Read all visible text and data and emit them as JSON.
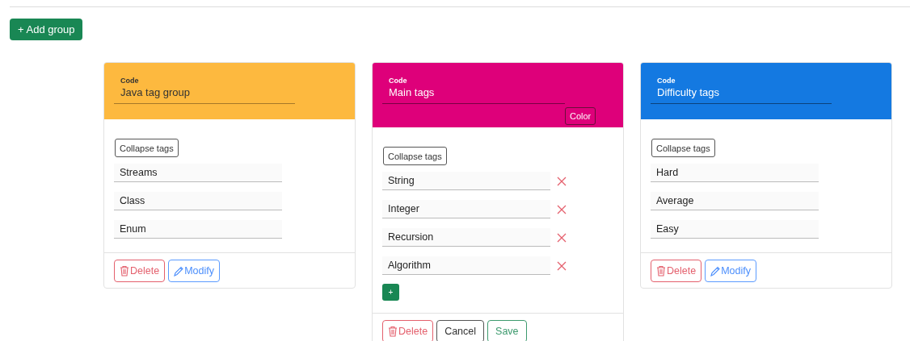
{
  "add_button": "+ Add group",
  "groups": [
    {
      "code_label": "Code",
      "code": "Java tag group",
      "color": "#fdb93f",
      "editing": false,
      "collapse_button": "Collapse tags",
      "tags": [
        "Streams",
        "Class",
        "Enum"
      ],
      "delete_button": "Delete",
      "modify_button": "Modify"
    },
    {
      "code_label": "Code",
      "code": "Main tags",
      "color": "#de007a",
      "editing": true,
      "color_button": "Color",
      "collapse_button": "Collapse tags",
      "tags": [
        "String",
        "Integer",
        "Recursion",
        "Algorithm"
      ],
      "add_tag_button": "+",
      "delete_button": "Delete",
      "cancel_button": "Cancel",
      "save_button": "Save"
    },
    {
      "code_label": "Code",
      "code": "Difficulty tags",
      "color": "#1479e1",
      "editing": false,
      "collapse_button": "Collapse tags",
      "tags": [
        "Hard",
        "Average",
        "Easy"
      ],
      "delete_button": "Delete",
      "modify_button": "Modify"
    }
  ]
}
